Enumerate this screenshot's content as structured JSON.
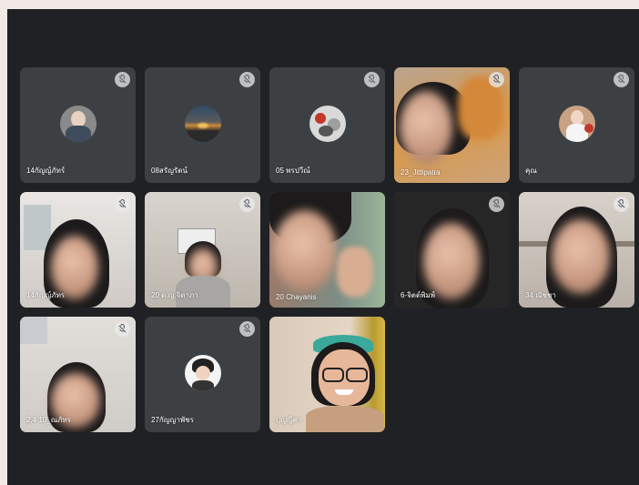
{
  "participants": [
    {
      "name": "14กัญญ์ภัทร์",
      "muted": true,
      "type": "avatar"
    },
    {
      "name": "08สรัญรัตน์",
      "muted": true,
      "type": "avatar"
    },
    {
      "name": "05 พรปวีณ์",
      "muted": true,
      "type": "avatar"
    },
    {
      "name": "23_Jittipatra",
      "muted": true,
      "type": "video"
    },
    {
      "name": "คุณ",
      "muted": true,
      "type": "avatar"
    },
    {
      "name": "14กัญญ์ภัทร",
      "muted": true,
      "type": "video"
    },
    {
      "name": "20 ด.ญ.จิดาภา",
      "muted": true,
      "type": "video"
    },
    {
      "name": "20 Chayanis",
      "muted": false,
      "type": "video"
    },
    {
      "name": "6-จิตต์พิมพ์",
      "muted": true,
      "type": "video"
    },
    {
      "name": "34 ณัชชา",
      "muted": true,
      "type": "video"
    },
    {
      "name": "2,4 10_ณภัทร",
      "muted": true,
      "type": "video"
    },
    {
      "name": "27กัญญาพัชร",
      "muted": true,
      "type": "avatar"
    },
    {
      "name": "ปุญญิศา",
      "muted": false,
      "type": "video"
    }
  ],
  "colors": {
    "background": "#202124",
    "tile": "#3c4043",
    "mute_badge": "#ebebeb",
    "border": "#f1e9e6"
  },
  "icons": {
    "mute": "mic-off-icon"
  }
}
